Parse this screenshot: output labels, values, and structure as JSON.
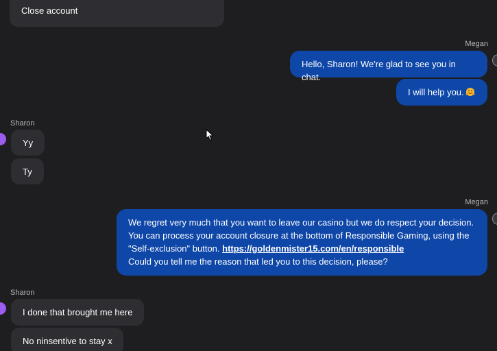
{
  "messages": {
    "top_partial": {
      "text": "Close account"
    },
    "agent_group_1": {
      "sender": "Megan",
      "bubble_1": "Hello, Sharon! We're glad to see you in chat.",
      "bubble_2": "I will help you."
    },
    "user_group_1": {
      "sender": "Sharon",
      "bubble_1": "Yy",
      "bubble_2": "Ty"
    },
    "agent_group_2": {
      "sender": "Megan",
      "line_1": "We regret very much that you want to leave our casino but we do respect your decision.",
      "line_2": "You can process your account closure at the bottom of Responsible Gaming, using the",
      "line_3_prefix": "\"Self-exclusion\" button. ",
      "link": "https://goldenmister15.com/en/responsible",
      "line_4": "Could you tell me the reason that led you to this decision, please?"
    },
    "user_group_2": {
      "sender": "Sharon",
      "bubble_1": "I done that brought me here",
      "bubble_2": "No ninsentive to stay x"
    }
  },
  "colors": {
    "background": "#1e1e21",
    "incoming_bubble": "#2e2e32",
    "outgoing_bubble": "#0f47a8",
    "user_avatar": "#9b5cf0"
  },
  "icons": {
    "emoji": "hugging-face-icon",
    "cursor": "mouse-pointer-icon"
  }
}
